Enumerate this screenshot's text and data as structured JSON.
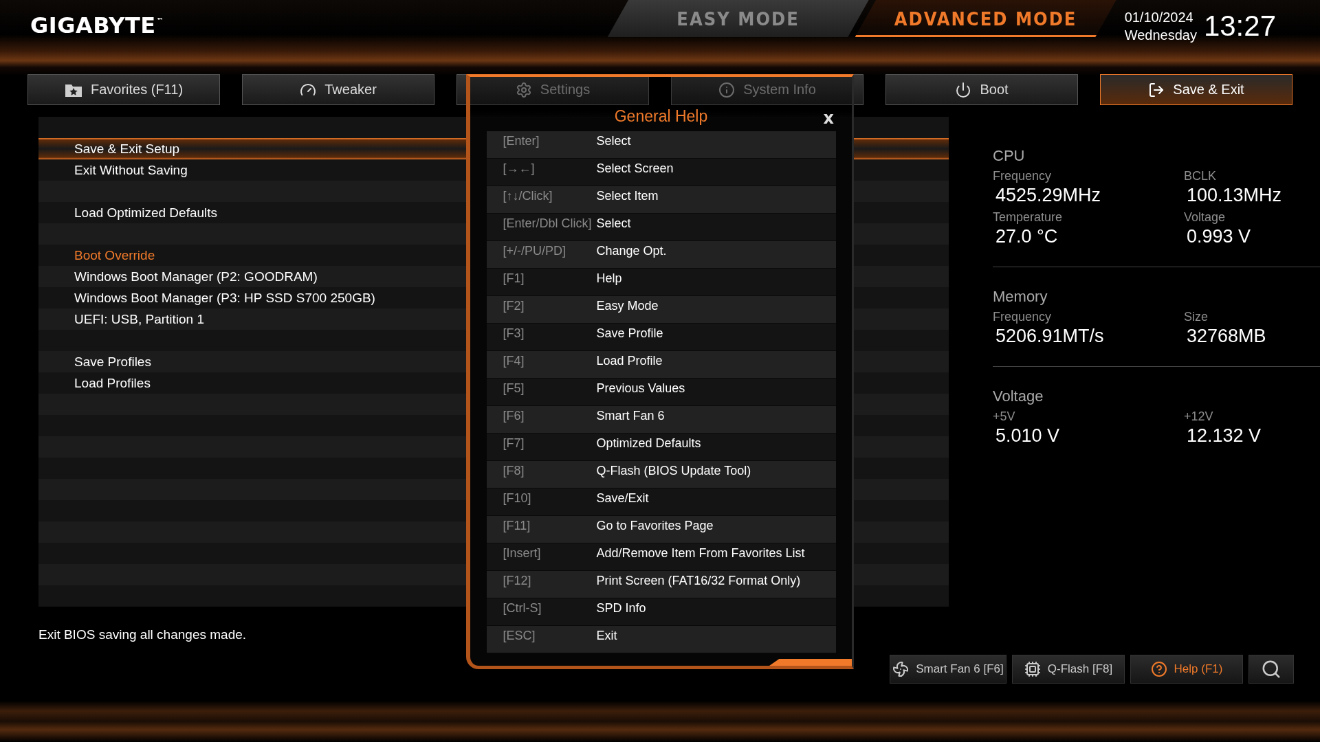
{
  "logo": {
    "name": "GIGABYTE",
    "mark": "™"
  },
  "modes": [
    {
      "label": "EASY MODE",
      "selected": false
    },
    {
      "label": "ADVANCED MODE",
      "selected": true
    }
  ],
  "clock": {
    "date": "01/10/2024",
    "day": "Wednesday",
    "time": "13:27"
  },
  "tabs": [
    {
      "label": "Favorites (F11)",
      "selected": false
    },
    {
      "label": "Tweaker",
      "selected": false
    },
    {
      "label": "Settings",
      "selected": false
    },
    {
      "label": "System Info",
      "selected": false
    },
    {
      "label": "Boot",
      "selected": false
    },
    {
      "label": "Save & Exit",
      "selected": true
    }
  ],
  "menu": [
    {
      "kind": "blank"
    },
    {
      "kind": "item",
      "label": "Save & Exit Setup",
      "selected": true
    },
    {
      "kind": "item",
      "label": "Exit Without Saving",
      "selected": false
    },
    {
      "kind": "blank"
    },
    {
      "kind": "item",
      "label": "Load Optimized Defaults",
      "selected": false
    },
    {
      "kind": "blank"
    },
    {
      "kind": "header",
      "label": "Boot Override"
    },
    {
      "kind": "item",
      "label": "Windows Boot Manager (P2: GOODRAM)",
      "selected": false
    },
    {
      "kind": "item",
      "label": "Windows Boot Manager (P3: HP SSD S700 250GB)",
      "selected": false
    },
    {
      "kind": "item",
      "label": "UEFI:  USB, Partition 1",
      "selected": false
    },
    {
      "kind": "blank"
    },
    {
      "kind": "item",
      "label": "Save Profiles",
      "selected": false
    },
    {
      "kind": "item",
      "label": "Load Profiles",
      "selected": false
    }
  ],
  "description": "Exit BIOS saving all changes made.",
  "help": {
    "title": "General Help",
    "close": "x",
    "rows": [
      {
        "key": "[Enter]",
        "action": "Select"
      },
      {
        "key": "[→←]",
        "action": "Select Screen"
      },
      {
        "key": "[↑↓/Click]",
        "action": "Select Item"
      },
      {
        "key": "[Enter/Dbl Click]",
        "action": "Select"
      },
      {
        "key": "[+/-/PU/PD]",
        "action": "Change Opt."
      },
      {
        "key": "[F1]",
        "action": "Help"
      },
      {
        "key": "[F2]",
        "action": "Easy Mode"
      },
      {
        "key": "[F3]",
        "action": "Save Profile"
      },
      {
        "key": "[F4]",
        "action": "Load Profile"
      },
      {
        "key": "[F5]",
        "action": "Previous Values"
      },
      {
        "key": "[F6]",
        "action": "Smart Fan 6"
      },
      {
        "key": "[F7]",
        "action": "Optimized Defaults"
      },
      {
        "key": "[F8]",
        "action": "Q-Flash (BIOS Update Tool)"
      },
      {
        "key": "[F10]",
        "action": "Save/Exit"
      },
      {
        "key": "[F11]",
        "action": "Go to Favorites Page"
      },
      {
        "key": "[Insert]",
        "action": "Add/Remove Item From Favorites List"
      },
      {
        "key": "[F12]",
        "action": "Print Screen (FAT16/32 Format Only)"
      },
      {
        "key": "[Ctrl-S]",
        "action": "SPD Info"
      },
      {
        "key": "[ESC]",
        "action": "Exit"
      }
    ]
  },
  "system": [
    {
      "title": "CPU",
      "fields": [
        {
          "label": "Frequency",
          "value": "4525.29MHz"
        },
        {
          "label": "BCLK",
          "value": "100.13MHz"
        },
        {
          "label": "Temperature",
          "value": "27.0 °C"
        },
        {
          "label": "Voltage",
          "value": "0.993 V"
        }
      ]
    },
    {
      "title": "Memory",
      "fields": [
        {
          "label": "Frequency",
          "value": "5206.91MT/s"
        },
        {
          "label": "Size",
          "value": "32768MB"
        }
      ]
    },
    {
      "title": "Voltage",
      "fields": [
        {
          "label": "+5V",
          "value": "5.010 V"
        },
        {
          "label": "+12V",
          "value": "12.132 V"
        }
      ]
    }
  ],
  "bottom_buttons": [
    {
      "label": "Smart Fan 6 [F6]",
      "selected": false
    },
    {
      "label": "Q-Flash [F8]",
      "selected": false
    },
    {
      "label": "Help (F1)",
      "selected": true
    },
    {
      "kind": "search",
      "selected": false
    }
  ]
}
